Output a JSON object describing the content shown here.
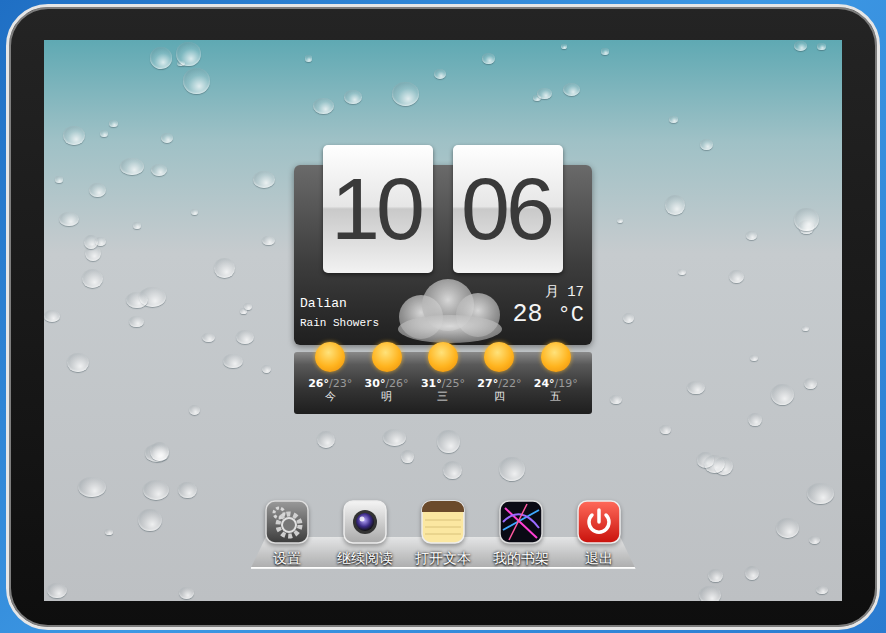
{
  "clock": {
    "hours": "10",
    "minutes": "06"
  },
  "weather": {
    "city": "Dalian",
    "condition": "Rain Showers",
    "date": "月 17",
    "temperature": "28",
    "unit": "°C"
  },
  "forecast": [
    {
      "high": "26°",
      "low": "/23°",
      "day": "今"
    },
    {
      "high": "30°",
      "low": "/26°",
      "day": "明"
    },
    {
      "high": "31°",
      "low": "/25°",
      "day": "三"
    },
    {
      "high": "27°",
      "low": "/22°",
      "day": "四"
    },
    {
      "high": "24°",
      "low": "/19°",
      "day": "五"
    }
  ],
  "dock": [
    {
      "label": "设置",
      "kind": "settings"
    },
    {
      "label": "继续阅读",
      "kind": "camera"
    },
    {
      "label": "打开文本",
      "kind": "notepad"
    },
    {
      "label": "我的书架",
      "kind": "bookshelf"
    },
    {
      "label": "退出",
      "kind": "power"
    }
  ]
}
